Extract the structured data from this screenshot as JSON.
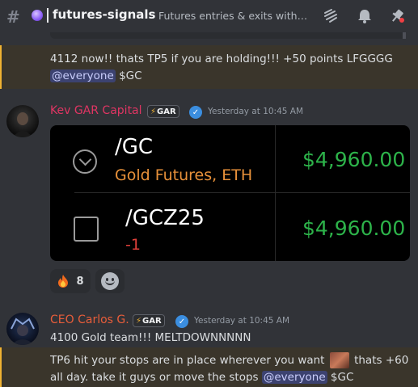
{
  "header": {
    "channel_name": "futures-signals",
    "topic": "Futures entries & exits with c...",
    "icons": [
      "hash-icon",
      "threads-icon",
      "bell-icon",
      "pin-icon"
    ]
  },
  "messages": [
    {
      "continuation": true,
      "text_before_mention": "4112 now!! thats TP5 if you are holding!!! +50 points LFGGGG",
      "mention": "@everyone",
      "text_after_mention": "$GC"
    },
    {
      "author": "Kev GAR Capital",
      "tag": "GAR",
      "timestamp": "Yesterday at 10:45 AM",
      "card": {
        "row1": {
          "symbol": "/GC",
          "subtitle": "Gold Futures, ETH",
          "price": "$4,960.00"
        },
        "row2": {
          "symbol": "/GCZ25",
          "subtitle": "-1",
          "price": "$4,960.00"
        }
      },
      "reactions": [
        {
          "emoji": "fire-emoji",
          "count": "8"
        }
      ]
    },
    {
      "author": "CEO Carlos G.",
      "tag": "GAR",
      "timestamp": "Yesterday at 10:45 AM",
      "line1": "4100 Gold team!!! MELTDOWNNNNN",
      "line2_a": "TP6 hit your stops are in place wherever you want",
      "line2_b": "thats +60",
      "line3_a": "all day. take it guys or move the stops",
      "line3_mention": "@everyone",
      "line3_b": "$GC"
    }
  ],
  "colors": {
    "background": "#313338",
    "mention_highlight": "#3a352b",
    "price_green": "#2db34a",
    "subtitle_orange": "#e8913a",
    "short_red": "#e0403a",
    "kev_name": "#e03563",
    "ceo_name": "#e85d3a"
  }
}
